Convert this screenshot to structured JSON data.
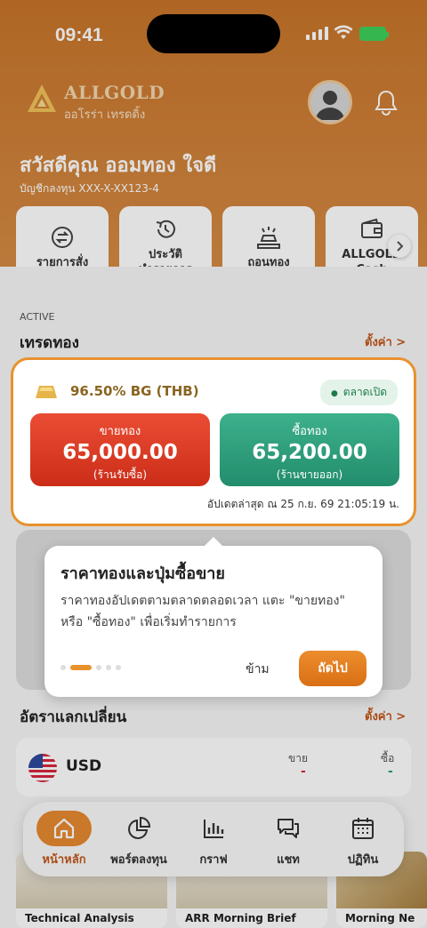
{
  "status_bar": {
    "time": "09:41"
  },
  "brand": {
    "name": "ALLGOLD",
    "subtitle": "ออโรร่า เทรดดิ้ง"
  },
  "greeting": {
    "text": "สวัสดีคุณ ออมทอง ใจดี",
    "account": "บัญชีกลงทุน XXX-X-XX123-4"
  },
  "menu": [
    {
      "label": "รายการสั่ง",
      "icon": "swap-icon"
    },
    {
      "label": "ประวัติ\nทำรายการ",
      "icon": "history-icon"
    },
    {
      "label": "ถอนทอง",
      "icon": "gold-bars-icon"
    },
    {
      "label": "ALLGOLD\nCash",
      "icon": "wallet-icon"
    }
  ],
  "active_label": "ACTIVE",
  "trade_section": {
    "title": "เทรดทอง",
    "settings": "ตั้งค่า >"
  },
  "gold_card": {
    "name": "96.50% BG (THB)",
    "market_status": "ตลาดเปิด",
    "sell": {
      "label": "ขายทอง",
      "price": "65,000.00",
      "sub": "(ร้านรับซื้อ)"
    },
    "buy": {
      "label": "ซื้อทอง",
      "price": "65,200.00",
      "sub": "(ร้านขายออก)"
    },
    "updated": "อัปเดตล่าสุด ณ 25 ก.ย. 69 21:05:19 น."
  },
  "tooltip": {
    "title": "ราคาทองและปุ่มซื้อขาย",
    "body": "ราคาทองอัปเดตตามตลาดตลอดเวลา แตะ \"ขายทอง\" หรือ \"ซื้อทอง\" เพื่อเริ่มทำรายการ",
    "skip": "ข้าม",
    "next": "ถัดไป",
    "step": 2,
    "total_steps": 5
  },
  "fx_section": {
    "title": "อัตราแลกเปลี่ยน",
    "settings": "ตั้งค่า >"
  },
  "fx_row": {
    "code": "USD",
    "sell_label": "ขาย",
    "buy_label": "ซื้อ",
    "sell_value": "-",
    "buy_value": "-"
  },
  "news": [
    {
      "title": "Technical Analysis"
    },
    {
      "title": "ARR Morning Brief"
    },
    {
      "title": "Morning Ne"
    }
  ],
  "bottom_nav": [
    {
      "label": "หน้าหลัก",
      "icon": "home-icon",
      "active": true
    },
    {
      "label": "พอร์ตลงทุน",
      "icon": "pie-chart-icon"
    },
    {
      "label": "กราฟ",
      "icon": "bar-chart-icon"
    },
    {
      "label": "แชท",
      "icon": "chat-icon"
    },
    {
      "label": "ปฏิทิน",
      "icon": "calendar-icon"
    }
  ],
  "colors": {
    "brand_orange": "#D0823A",
    "sell_red": "#DC3A24",
    "buy_green": "#2E9E7C",
    "accent": "#E8922E"
  }
}
